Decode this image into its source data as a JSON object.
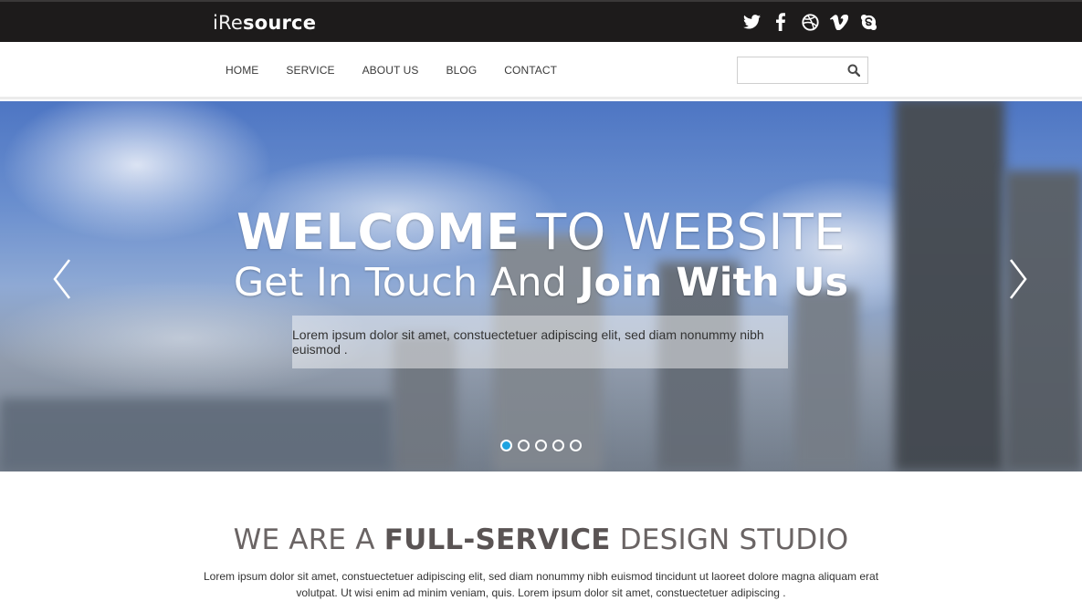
{
  "brand": {
    "light": "iRe",
    "bold": "source"
  },
  "social": [
    "twitter-icon",
    "facebook-icon",
    "dribbble-icon",
    "vimeo-icon",
    "skype-icon"
  ],
  "nav": {
    "items": [
      "HOME",
      "SERVICE",
      "ABOUT US",
      "BLOG",
      "CONTACT"
    ]
  },
  "search": {
    "placeholder": "",
    "value": ""
  },
  "hero": {
    "line1_bold": "WELCOME",
    "line1_light": " TO WEBSITE",
    "line2_light": "Get In Touch And ",
    "line2_bold": "Join With Us",
    "caption": "Lorem ipsum dolor sit amet, constuectetuer adipiscing elit, sed diam nonummy nibh euismod .",
    "slide_count": 5,
    "active_slide": 1
  },
  "about": {
    "title_light1": "WE ARE A ",
    "title_bold": "FULL-SERVICE",
    "title_light2": " DESIGN STUDIO",
    "text": "Lorem ipsum dolor sit amet, constuectetuer adipiscing elit, sed diam nonummy nibh euismod tincidunt ut laoreet dolore magna aliquam erat volutpat. Ut wisi enim ad minim veniam, quis. Lorem ipsum dolor sit amet, constuectetuer adipiscing ."
  },
  "colors": {
    "topbar": "#1d1b1b",
    "accent": "#1ea3e0",
    "heading": "#6a6464"
  }
}
